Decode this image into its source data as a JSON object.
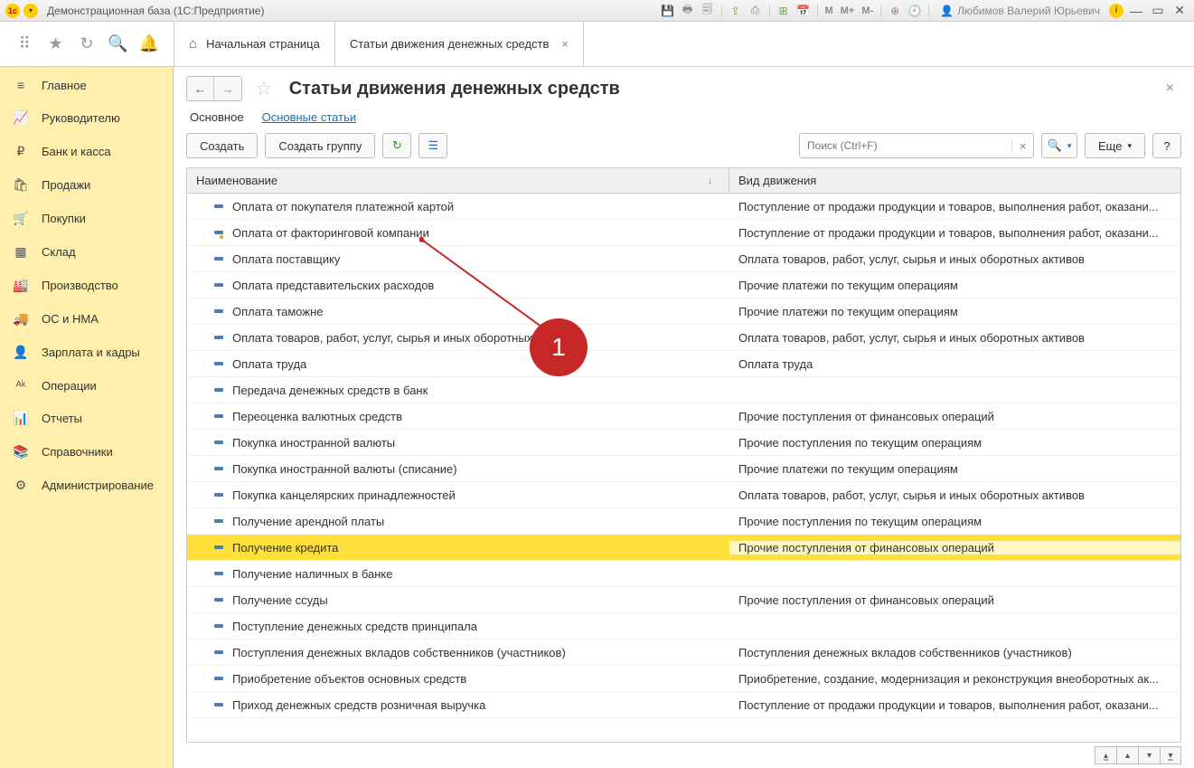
{
  "titlebar": {
    "title": "Демонстрационная база  (1С:Предприятие)",
    "m": "M",
    "mplus": "M+",
    "mminus": "M-",
    "user": "Любимов Валерий Юрьевич"
  },
  "toptabs": {
    "home": "Начальная страница",
    "active": "Статьи движения денежных средств"
  },
  "sidebar": [
    {
      "icon": "≡",
      "label": "Главное"
    },
    {
      "icon": "📈",
      "label": "Руководителю"
    },
    {
      "icon": "₽",
      "label": "Банк и касса"
    },
    {
      "icon": "🛍",
      "label": "Продажи"
    },
    {
      "icon": "🛒",
      "label": "Покупки"
    },
    {
      "icon": "▦",
      "label": "Склад"
    },
    {
      "icon": "🏭",
      "label": "Производство"
    },
    {
      "icon": "🚚",
      "label": "ОС и НМА"
    },
    {
      "icon": "👤",
      "label": "Зарплата и кадры"
    },
    {
      "icon": "ᴬᵏ",
      "label": "Операции"
    },
    {
      "icon": "📊",
      "label": "Отчеты"
    },
    {
      "icon": "📚",
      "label": "Справочники"
    },
    {
      "icon": "⚙",
      "label": "Администрирование"
    }
  ],
  "page": {
    "title": "Статьи движения денежных средств",
    "subtab_main": "Основное",
    "subtab_link": "Основные статьи"
  },
  "actions": {
    "create": "Создать",
    "create_group": "Создать группу",
    "more": "Еще",
    "search_placeholder": "Поиск (Ctrl+F)"
  },
  "table": {
    "col_name": "Наименование",
    "col_kind": "Вид движения",
    "rows": [
      {
        "name": "Оплата от покупателя платежной картой",
        "kind": "Поступление от продажи продукции и товаров, выполнения работ, оказани...",
        "special": false
      },
      {
        "name": "Оплата от факторинговой компании",
        "kind": "Поступление от продажи продукции и товаров, выполнения работ, оказани...",
        "special": true
      },
      {
        "name": "Оплата поставщику",
        "kind": "Оплата товаров, работ, услуг, сырья и иных оборотных активов",
        "special": false
      },
      {
        "name": "Оплата представительских расходов",
        "kind": "Прочие платежи по текущим операциям",
        "special": false
      },
      {
        "name": "Оплата таможне",
        "kind": "Прочие платежи по текущим операциям",
        "special": false
      },
      {
        "name": "Оплата товаров, работ, услуг, сырья и иных оборотных активов",
        "kind": "Оплата товаров, работ, услуг, сырья и иных оборотных активов",
        "special": false
      },
      {
        "name": "Оплата труда",
        "kind": "Оплата труда",
        "special": false
      },
      {
        "name": "Передача денежных средств в банк",
        "kind": "",
        "special": false
      },
      {
        "name": "Переоценка валютных средств",
        "kind": "Прочие поступления от финансовых операций",
        "special": false
      },
      {
        "name": "Покупка иностранной валюты",
        "kind": "Прочие поступления по текущим операциям",
        "special": false
      },
      {
        "name": "Покупка иностранной валюты (списание)",
        "kind": "Прочие платежи по текущим операциям",
        "special": false
      },
      {
        "name": "Покупка канцелярских принадлежностей",
        "kind": "Оплата товаров, работ, услуг, сырья и иных оборотных активов",
        "special": false
      },
      {
        "name": "Получение арендной платы",
        "kind": "Прочие поступления по текущим операциям",
        "special": false
      },
      {
        "name": "Получение кредита",
        "kind": "Прочие поступления от финансовых операций",
        "special": false,
        "selected": true
      },
      {
        "name": "Получение наличных в банке",
        "kind": "",
        "special": false
      },
      {
        "name": "Получение ссуды",
        "kind": "Прочие поступления от финансовых операций",
        "special": false
      },
      {
        "name": "Поступление денежных средств принципала",
        "kind": "",
        "special": false
      },
      {
        "name": "Поступления денежных вкладов собственников (участников)",
        "kind": "Поступления денежных вкладов собственников (участников)",
        "special": false
      },
      {
        "name": "Приобретение объектов основных средств",
        "kind": "Приобретение, создание, модернизация и реконструкция внеоборотных ак...",
        "special": false
      },
      {
        "name": "Приход денежных средств розничная выручка",
        "kind": "Поступление от продажи продукции и товаров, выполнения работ, оказани...",
        "special": false
      }
    ]
  },
  "annotation": {
    "badge": "1"
  }
}
